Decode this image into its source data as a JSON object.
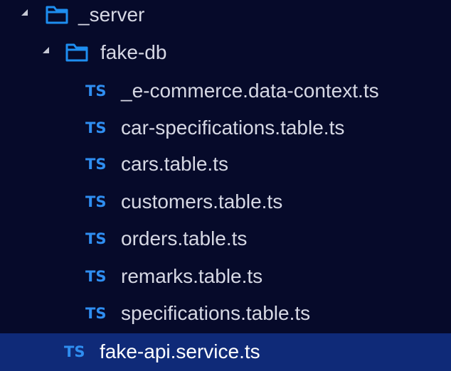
{
  "explorer": {
    "items": [
      {
        "type": "folder",
        "label": "_server",
        "expanded": true,
        "level": 0
      },
      {
        "type": "folder",
        "label": "fake-db",
        "expanded": true,
        "level": 1
      },
      {
        "type": "file",
        "icon": "TS",
        "label": "_e-commerce.data-context.ts",
        "level": 2
      },
      {
        "type": "file",
        "icon": "TS",
        "label": "car-specifications.table.ts",
        "level": 2
      },
      {
        "type": "file",
        "icon": "TS",
        "label": "cars.table.ts",
        "level": 2
      },
      {
        "type": "file",
        "icon": "TS",
        "label": "customers.table.ts",
        "level": 2
      },
      {
        "type": "file",
        "icon": "TS",
        "label": "orders.table.ts",
        "level": 2
      },
      {
        "type": "file",
        "icon": "TS",
        "label": "remarks.table.ts",
        "level": 2
      },
      {
        "type": "file",
        "icon": "TS",
        "label": "specifications.table.ts",
        "level": 2
      },
      {
        "type": "file",
        "icon": "TS",
        "label": "fake-api.service.ts",
        "level": 1,
        "selected": true
      }
    ]
  },
  "colors": {
    "background": "#060a2a",
    "selected_row": "#0f2a78",
    "folder_icon": "#1e8ef0",
    "ts_icon": "#2f8ef1",
    "text": "#d6d8e4"
  }
}
